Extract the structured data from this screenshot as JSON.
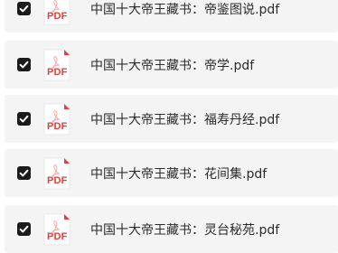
{
  "files": [
    {
      "name": "中国十大帝王藏书：帝鉴图说.pdf",
      "checked": true,
      "icon": "pdf-file-icon",
      "icon_label": "PDF"
    },
    {
      "name": "中国十大帝王藏书：帝学.pdf",
      "checked": true,
      "icon": "pdf-file-icon",
      "icon_label": "PDF"
    },
    {
      "name": "中国十大帝王藏书：福寿丹经.pdf",
      "checked": true,
      "icon": "pdf-file-icon",
      "icon_label": "PDF"
    },
    {
      "name": "中国十大帝王藏书：花间集.pdf",
      "checked": true,
      "icon": "pdf-file-icon",
      "icon_label": "PDF"
    },
    {
      "name": "中国十大帝王藏书：灵台秘苑.pdf",
      "checked": true,
      "icon": "pdf-file-icon",
      "icon_label": "PDF"
    }
  ],
  "colors": {
    "row_background": "#f4f4f5",
    "checkbox": "#1b1b1b",
    "pdf_red": "#e0403a",
    "text": "#2b2b2b"
  }
}
